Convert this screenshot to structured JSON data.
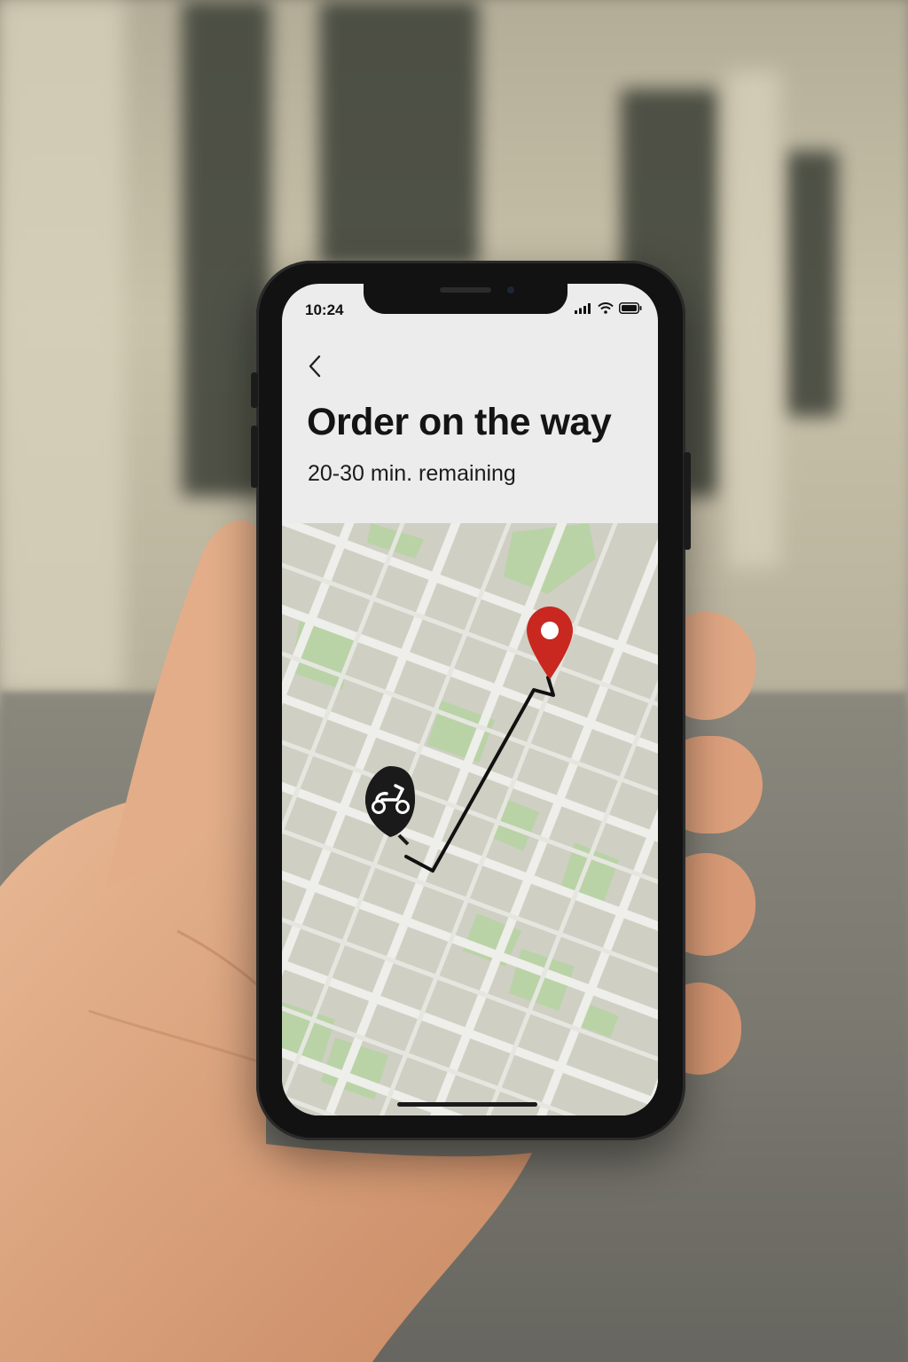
{
  "status_bar": {
    "time": "10:24",
    "icons": [
      "signal-icon",
      "wifi-icon",
      "battery-icon"
    ]
  },
  "header": {
    "back_icon": "chevron-left-icon",
    "title": "Order on the way",
    "subtitle": "20-30 min. remaining"
  },
  "map": {
    "courier_icon": "scooter-icon",
    "destination_icon": "location-pin-icon",
    "colors": {
      "land": "#cfcfc4",
      "road": "#eeeeea",
      "park": "#b9d3a6",
      "route": "#111111",
      "pin": "#c8281f",
      "courier_badge": "#1a1a1a"
    }
  }
}
